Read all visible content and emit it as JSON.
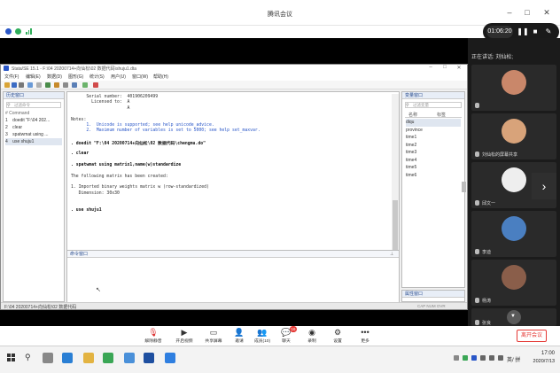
{
  "meeting": {
    "title": "腾讯会议",
    "timer": "01:06:20",
    "speaking_label": "正在讲话: 刘仙松;",
    "leave_label": "离开会议",
    "chat_badge": "16",
    "toolbar": [
      {
        "icon": "mic-off-icon",
        "label": "解除静音"
      },
      {
        "icon": "camera-icon",
        "label": "开启视频"
      },
      {
        "icon": "share-screen-icon",
        "label": "共享屏幕"
      },
      {
        "icon": "invite-icon",
        "label": "邀请"
      },
      {
        "icon": "members-icon",
        "label": "成员(10)"
      },
      {
        "icon": "chat-icon",
        "label": "聊天"
      },
      {
        "icon": "record-icon",
        "label": "录制"
      },
      {
        "icon": "settings-icon",
        "label": "设置"
      },
      {
        "icon": "more-icon",
        "label": "更多"
      }
    ],
    "participants": [
      {
        "name": "",
        "color": "#c9876a"
      },
      {
        "name": "刘仙松的屏幕共享",
        "color": "#d8a37a"
      },
      {
        "name": "邱文一",
        "color": "#eeeeee"
      },
      {
        "name": "李迪",
        "color": "#4a7fc1"
      },
      {
        "name": "杨涛",
        "color": "#8a5e4a"
      },
      {
        "name": "张良",
        "color": "#5a5a5a"
      }
    ]
  },
  "stata": {
    "title": "Stata/SE 15.1 - F:\\04 20200714+向仙松\\02 数据代码\\shuju1.dta",
    "menus": [
      "文件(F)",
      "编辑(E)",
      "数据(D)",
      "图形(G)",
      "统计(S)",
      "用户(U)",
      "窗口(W)",
      "帮助(H)"
    ],
    "history": {
      "title": "历史窗口",
      "filter_placeholder": "过滤命令",
      "header": "#  Command",
      "rows": [
        {
          "n": "1",
          "cmd": "doedit \"F:\\04 202..."
        },
        {
          "n": "2",
          "cmd": "clear"
        },
        {
          "n": "3",
          "cmd": "spatwmat using ..."
        },
        {
          "n": "4",
          "cmd": "use shuju1"
        }
      ]
    },
    "results": {
      "lines": [
        {
          "text": "      Serial number:  401906209499",
          "kind": "plain"
        },
        {
          "text": "        Licensed to:  A",
          "kind": "plain"
        },
        {
          "text": "                      A",
          "kind": "plain"
        },
        {
          "text": "",
          "kind": "plain"
        },
        {
          "text": "Notes:",
          "kind": "plain"
        },
        {
          "text": "      1.  Unicode is supported; see help unicode_advice.",
          "kind": "link"
        },
        {
          "text": "      2.  Maximum number of variables is set to 5000; see help set_maxvar.",
          "kind": "link"
        },
        {
          "text": "",
          "kind": "plain"
        },
        {
          "text": ". doedit \"F:\\04 20200714+向仙松\\02 数据代码\\chengmu.do\"",
          "kind": "cmd"
        },
        {
          "text": "",
          "kind": "plain"
        },
        {
          "text": ". clear",
          "kind": "cmd"
        },
        {
          "text": "",
          "kind": "plain"
        },
        {
          "text": ". spatwmat using matrix1,name(w)standardize",
          "kind": "cmd"
        },
        {
          "text": "",
          "kind": "plain"
        },
        {
          "text": "The following matrix has been created:",
          "kind": "plain"
        },
        {
          "text": "",
          "kind": "plain"
        },
        {
          "text": "1. Imported binary weights matrix w (row-standardized)",
          "kind": "plain"
        },
        {
          "text": "   Dimension: 30x30",
          "kind": "plain"
        },
        {
          "text": "",
          "kind": "plain"
        },
        {
          "text": "",
          "kind": "plain"
        },
        {
          "text": ". use shuju1",
          "kind": "cmd"
        }
      ]
    },
    "command": {
      "title": "命令窗口"
    },
    "variables": {
      "title": "变量窗口",
      "filter_placeholder": "过滤变量",
      "col_name": "名称",
      "col_label": "标签",
      "rows": [
        "diqu",
        "province",
        "time1",
        "time2",
        "time3",
        "time4",
        "time5",
        "time6"
      ]
    },
    "properties": {
      "title": "属性窗口"
    },
    "status": {
      "path": "F:\\04 20200714+向仙松\\02 数据代码",
      "flags": "CAP  NUM  OVR"
    }
  },
  "taskbar": {
    "time": "17:00",
    "date": "2020/7/13",
    "ime": "英/ 拼"
  },
  "colors": {
    "accent_blue": "#2a57c8",
    "leave_red": "#e53935",
    "panel_dark": "#1b1b1b"
  }
}
